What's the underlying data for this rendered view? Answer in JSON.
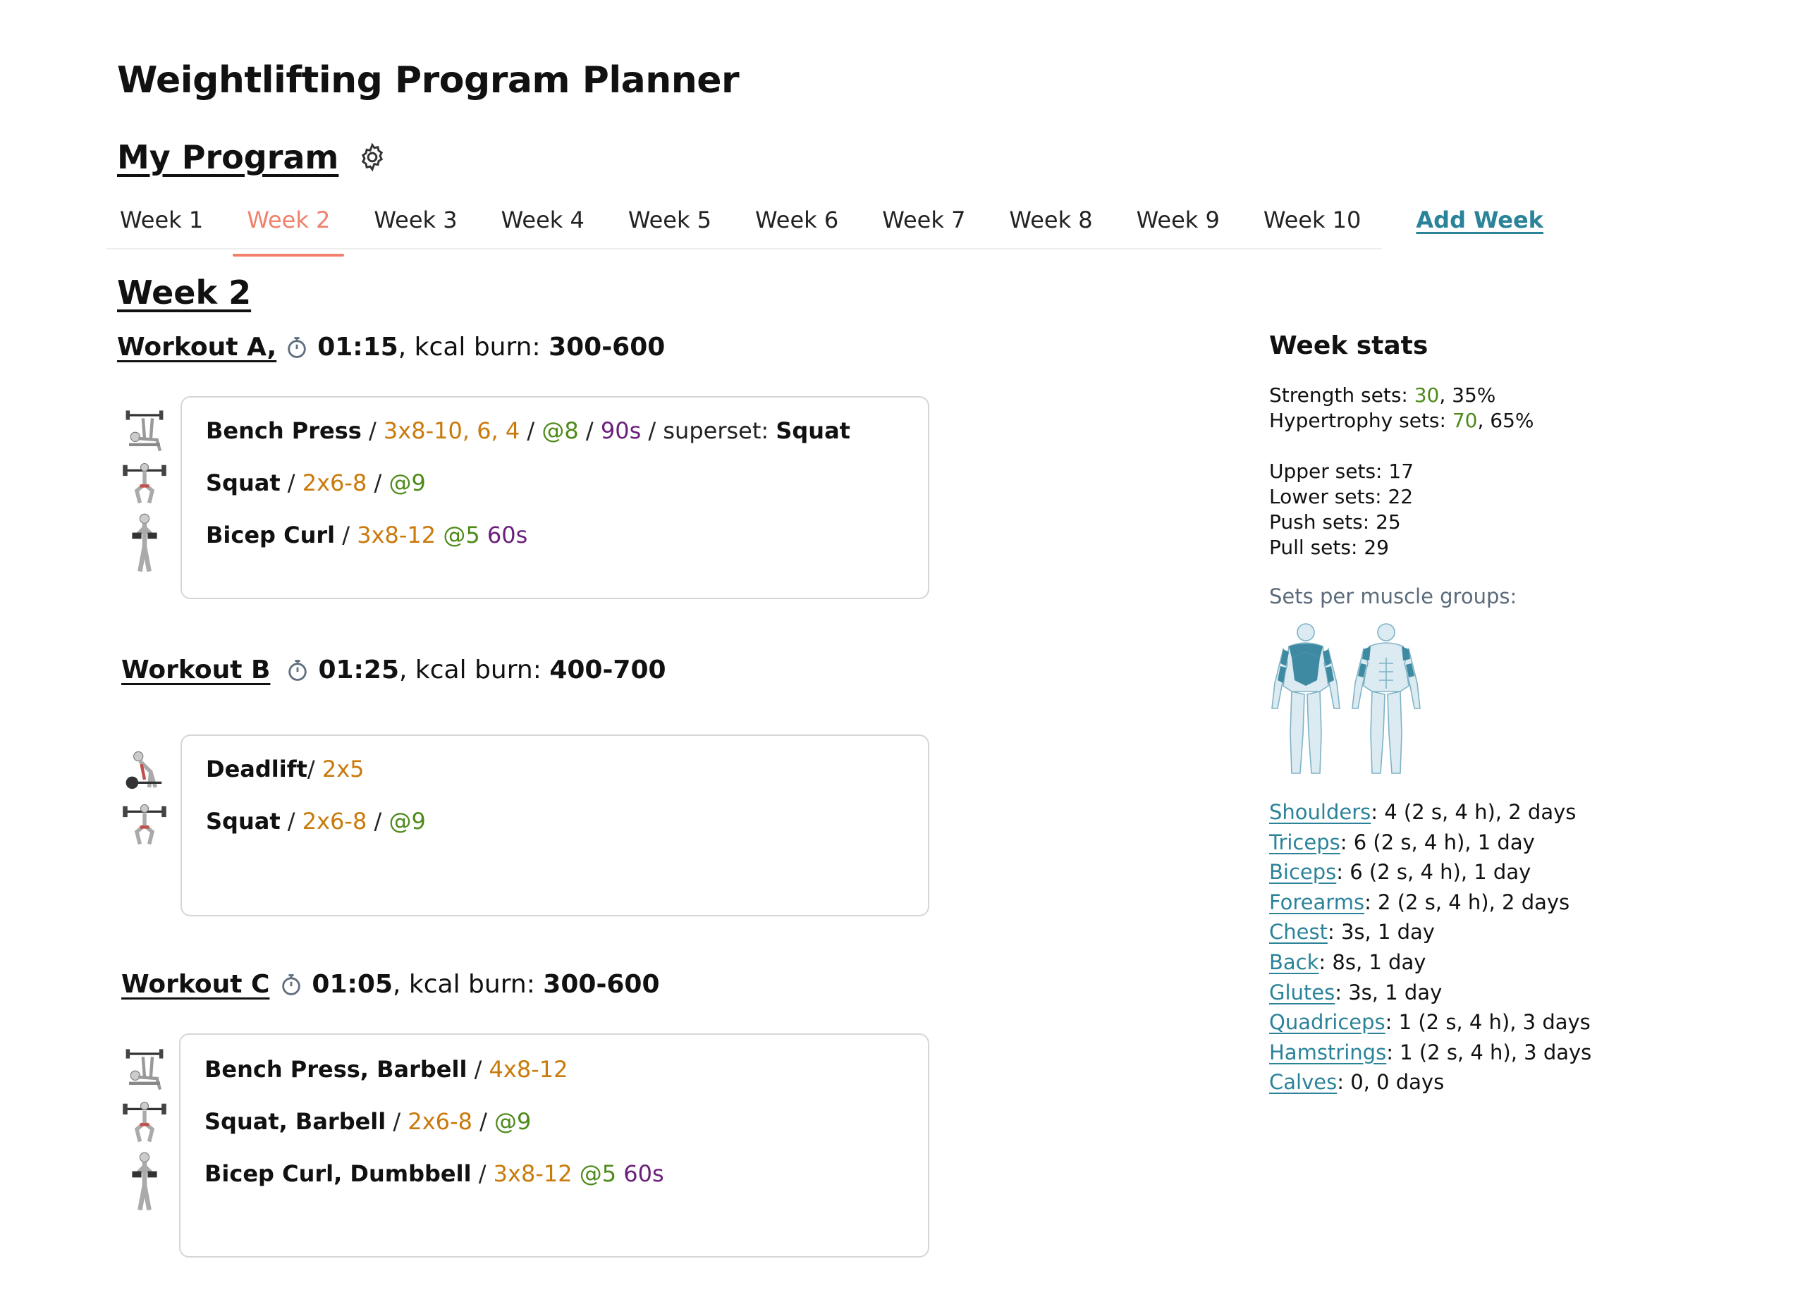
{
  "app": {
    "title": "Weightlifting Program Planner"
  },
  "program": {
    "title": "My Program"
  },
  "tabs": [
    {
      "label": "Week 1",
      "active": false
    },
    {
      "label": "Week 2",
      "active": true
    },
    {
      "label": "Week 3",
      "active": false
    },
    {
      "label": "Week 4",
      "active": false
    },
    {
      "label": "Week 5",
      "active": false
    },
    {
      "label": "Week 6",
      "active": false
    },
    {
      "label": "Week 7",
      "active": false
    },
    {
      "label": "Week 8",
      "active": false
    },
    {
      "label": "Week 9",
      "active": false
    },
    {
      "label": "Week 10",
      "active": false
    }
  ],
  "add_week_label": "Add Week",
  "week_title": "Week 2",
  "workouts": [
    {
      "name": "Workout A,",
      "duration": "01:15",
      "kcal_label": ", kcal burn:",
      "kcal": "300-600",
      "exercises": [
        {
          "name": "Bench Press",
          "sep1": " / ",
          "sets": "3x8-10, 6, 4",
          "sep2": " / ",
          "rpe": "@8",
          "sep3": " / ",
          "rest": "90s",
          "sep4": " / superset: ",
          "superset": "Squat"
        },
        {
          "name": "Squat",
          "sep1": " / ",
          "sets": "2x6-8",
          "sep2": " / ",
          "rpe": "@9"
        },
        {
          "name": "Bicep Curl",
          "sep1": " / ",
          "sets": "3x8-12",
          "rpe": " @5",
          "rest": " 60s"
        }
      ]
    },
    {
      "name": "Workout B",
      "duration": "01:25",
      "kcal_label": ", kcal burn:",
      "kcal": "400-700",
      "exercises": [
        {
          "name": "Deadlift",
          "sep1": "/ ",
          "sets": "2x5"
        },
        {
          "name": "Squat",
          "sep1": " / ",
          "sets": "2x6-8",
          "sep2": " / ",
          "rpe": "@9"
        }
      ]
    },
    {
      "name": "Workout C",
      "duration": "01:05",
      "kcal_label": ", kcal burn:",
      "kcal": "300-600",
      "exercises": [
        {
          "name": "Bench Press, Barbell",
          "sep1": " / ",
          "sets": "4x8-12"
        },
        {
          "name": "Squat, Barbell",
          "sep1": " / ",
          "sets": "2x6-8",
          "sep2": " / ",
          "rpe": "@9"
        },
        {
          "name": "Bicep Curl, Dumbbell",
          "sep1": " / ",
          "sets": "3x8-12",
          "rpe": " @5",
          "rest": " 60s"
        }
      ]
    }
  ],
  "stats": {
    "title": "Week stats",
    "strength_label": "Strength sets: ",
    "strength_value": "30",
    "strength_pct": ", 35%",
    "hypertrophy_label": "Hypertrophy sets: ",
    "hypertrophy_value": "70",
    "hypertrophy_pct": ", 65%",
    "upper": "Upper sets: 17",
    "lower": "Lower sets: 22",
    "push": "Push sets: 25",
    "pull": "Pull sets: 29",
    "muscle_groups_label": "Sets per muscle groups:",
    "muscles": [
      {
        "name": "Shoulders",
        "detail": ": 4 (2 s, 4 h), 2 days"
      },
      {
        "name": "Triceps",
        "detail": ": 6 (2 s, 4 h), 1 day"
      },
      {
        "name": "Biceps",
        "detail": ": 6 (2 s, 4 h), 1 day"
      },
      {
        "name": "Forearms",
        "detail": ": 2 (2 s, 4 h), 2 days"
      },
      {
        "name": "Chest",
        "detail": ": 3s, 1 day"
      },
      {
        "name": "Back",
        "detail": ": 8s, 1 day"
      },
      {
        "name": "Glutes",
        "detail": ": 3s, 1 day"
      },
      {
        "name": "Quadriceps",
        "detail": ": 1 (2 s, 4 h), 3 days"
      },
      {
        "name": "Hamstrings",
        "detail": ": 1 (2 s, 4 h), 3 days"
      },
      {
        "name": "Calves",
        "detail": ":  0, 0 days"
      }
    ]
  },
  "colors": {
    "accent": "#f0806a",
    "link": "#2b8399",
    "sets": "#c97a0a",
    "rpe": "#4e8a1a",
    "rest": "#6b1f7a",
    "muscle_fill": "#3f8aa3"
  },
  "icons": [
    "gear-icon",
    "stopwatch-icon",
    "bench-press-icon",
    "squat-icon",
    "bicep-curl-icon",
    "deadlift-icon",
    "body-back-icon",
    "body-front-icon"
  ]
}
